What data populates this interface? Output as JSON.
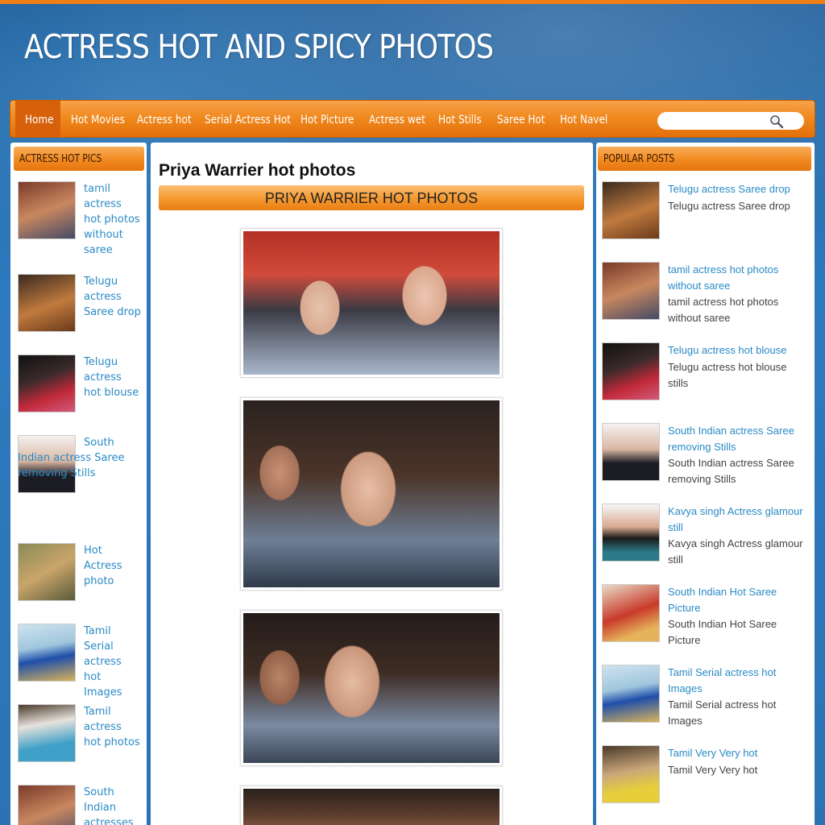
{
  "site": {
    "title": "ACTRESS HOT AND SPICY PHOTOS"
  },
  "nav": {
    "items": [
      "Home",
      "Hot Movies",
      "Actress hot",
      "Serial Actress Hot",
      "Hot Picture",
      "Actress wet",
      "Hot Stills",
      "Saree Hot",
      "Hot Navel"
    ],
    "search_placeholder": ""
  },
  "left": {
    "heading": "ACTRESS HOT PICS",
    "items": [
      {
        "label": "tamil actress hot photos without saree"
      },
      {
        "label": "Telugu actress Saree drop"
      },
      {
        "label": "Telugu actress hot blouse"
      },
      {
        "label": "South Indian actress Saree removing Stills"
      },
      {
        "label": "Hot Actress photo"
      },
      {
        "label": "Tamil Serial actress hot Images"
      },
      {
        "label": "Tamil actress hot photos"
      },
      {
        "label": "South Indian actresses"
      }
    ]
  },
  "post": {
    "title": "Priya Warrier hot photos",
    "banner": "PRIYA WARRIER HOT PHOTOS"
  },
  "right": {
    "heading": "POPULAR POSTS",
    "items": [
      {
        "title": "Telugu actress Saree drop",
        "desc": "Telugu actress Saree drop"
      },
      {
        "title": "tamil actress hot photos without saree",
        "desc": "tamil actress hot photos without saree"
      },
      {
        "title": "Telugu actress hot blouse",
        "desc": "Telugu actress hot blouse stills"
      },
      {
        "title": "South Indian actress Saree removing Stills",
        "desc": "South Indian actress Saree removing Stills"
      },
      {
        "title": "Kavya singh Actress glamour still",
        "desc": "Kavya singh Actress glamour still"
      },
      {
        "title": "South Indian Hot Saree Picture",
        "desc": "South Indian Hot Saree Picture"
      },
      {
        "title": "Tamil Serial actress hot Images",
        "desc": "Tamil Serial actress hot Images"
      },
      {
        "title": "Tamil Very Very hot",
        "desc": "Tamil Very Very hot"
      }
    ]
  },
  "colors": {
    "accent": "#f08a1f",
    "link": "#2a8ac6",
    "header_bg": "#2b73b5"
  },
  "icons": {
    "search": "magnifier-icon"
  }
}
